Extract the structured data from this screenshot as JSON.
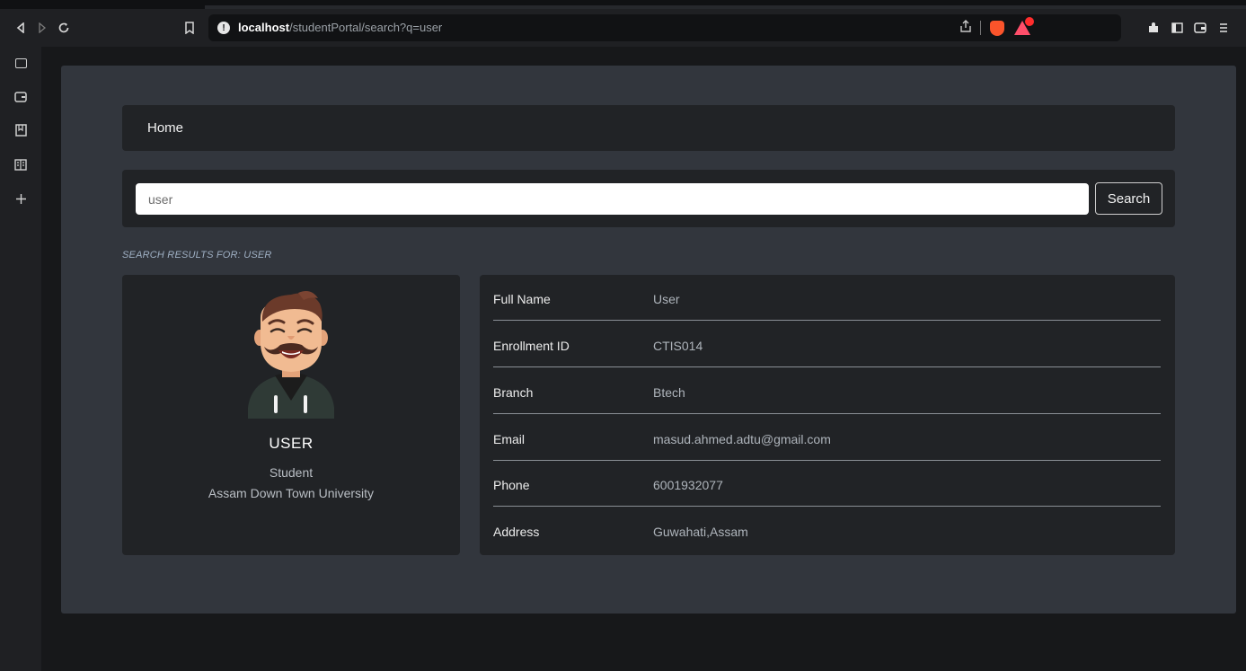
{
  "browser": {
    "url_host": "localhost",
    "url_path": "/studentPortal/search?q=user",
    "url_info_glyph": "!",
    "icons": [
      "back-icon",
      "forward-icon",
      "reload-icon",
      "bookmark-icon",
      "share-icon",
      "brave-shields-icon",
      "brave-rewards-icon",
      "extensions-icon",
      "sidebar-toggle-icon",
      "wallet-icon",
      "menu-icon"
    ]
  },
  "sidebar_icons": [
    "tab-icon",
    "wallet-icon",
    "bookmarks-icon",
    "reading-list-icon",
    "add-icon"
  ],
  "nav": {
    "home_label": "Home"
  },
  "search": {
    "value": "user",
    "button_label": "Search"
  },
  "results": {
    "heading": "SEARCH RESULTS FOR: USER"
  },
  "profile": {
    "name": "USER",
    "role": "Student",
    "university": "Assam Down Town University"
  },
  "details": [
    {
      "label": "Full Name",
      "value": "User"
    },
    {
      "label": "Enrollment ID",
      "value": "CTIS014"
    },
    {
      "label": "Branch",
      "value": "Btech"
    },
    {
      "label": "Email",
      "value": "masud.ahmed.adtu@gmail.com"
    },
    {
      "label": "Phone",
      "value": "6001932077"
    },
    {
      "label": "Address",
      "value": "Guwahati,Assam"
    }
  ]
}
